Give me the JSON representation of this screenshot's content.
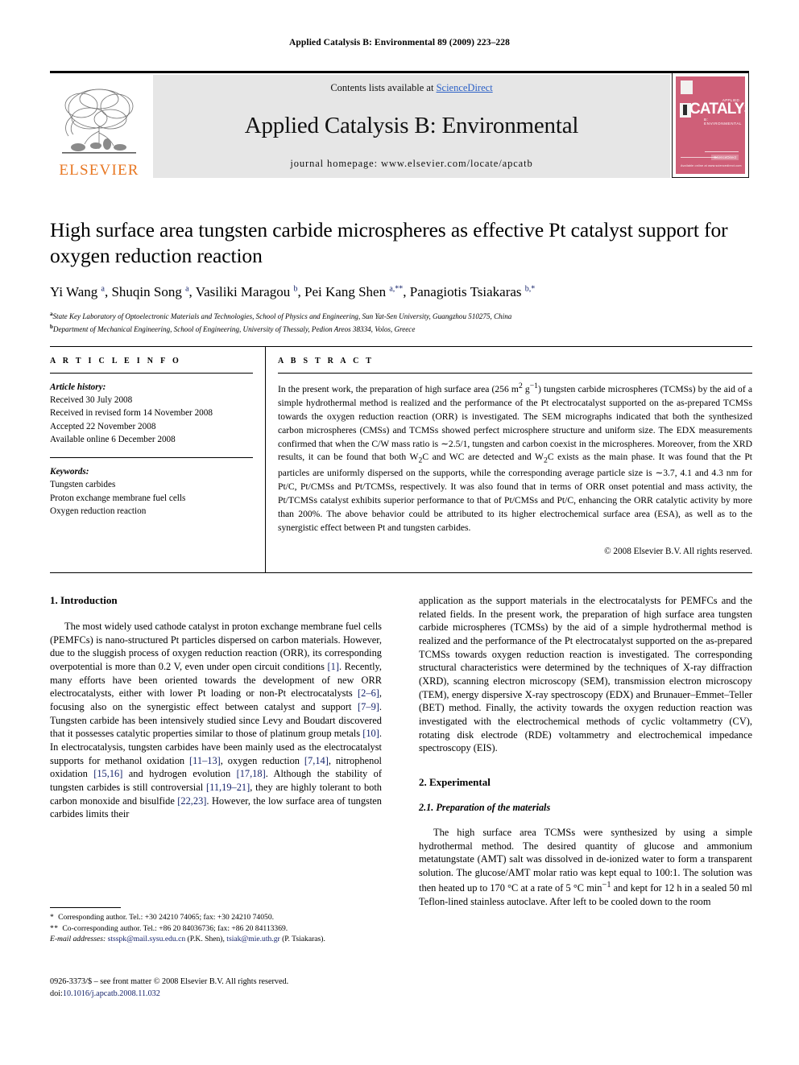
{
  "running_head": "Applied Catalysis B: Environmental 89 (2009) 223–228",
  "masthead": {
    "contents_prefix": "Contents lists available at ",
    "sciencedirect": "ScienceDirect",
    "journal_title": "Applied Catalysis B: Environmental",
    "homepage": "journal homepage: www.elsevier.com/locate/apcatb",
    "publisher_wordmark": "ELSEVIER",
    "cover": {
      "title": "CATALYSIS",
      "overline": "APPLIED",
      "subtitle": "B: ENVIRONMENTAL",
      "badge": "ScienceDirect",
      "footer": "Available online at www.sciencedirect.com"
    }
  },
  "article": {
    "title": "High surface area tungsten carbide microspheres as effective Pt catalyst support for oxygen reduction reaction",
    "authors_html": "Yi Wang <sup>a</sup>, Shuqin Song <sup>a</sup>, Vasiliki Maragou <sup>b</sup>, Pei Kang Shen <sup>a,**</sup>, Panagiotis Tsiakaras <sup>b,*</sup>",
    "affiliations": [
      "State Key Laboratory of Optoelectronic Materials and Technologies, School of Physics and Engineering, Sun Yat-Sen University, Guangzhou 510275, China",
      "Department of Mechanical Engineering, School of Engineering, University of Thessaly, Pedion Areos 38334, Volos, Greece"
    ],
    "affiliation_marks": [
      "a",
      "b"
    ]
  },
  "info": {
    "label": "A R T I C L E  I N F O",
    "history_label": "Article history:",
    "history": [
      "Received 30 July 2008",
      "Received in revised form 14 November 2008",
      "Accepted 22 November 2008",
      "Available online 6 December 2008"
    ],
    "keywords_label": "Keywords:",
    "keywords": [
      "Tungsten carbides",
      "Proton exchange membrane fuel cells",
      "Oxygen reduction reaction"
    ]
  },
  "abstract": {
    "label": "A B S T R A C T",
    "text_html": "In the present work, the preparation of high surface area (256 m<sup>2</sup> g<sup>−1</sup>) tungsten carbide microspheres (TCMSs) by the aid of a simple hydrothermal method is realized and the performance of the Pt electrocatalyst supported on the as-prepared TCMSs towards the oxygen reduction reaction (ORR) is investigated. The SEM micrographs indicated that both the synthesized carbon microspheres (CMSs) and TCMSs showed perfect microsphere structure and uniform size. The EDX measurements confirmed that when the C/W mass ratio is ∼2.5/1, tungsten and carbon coexist in the microspheres. Moreover, from the XRD results, it can be found that both W<sub>2</sub>C and WC are detected and W<sub>2</sub>C exists as the main phase. It was found that the Pt particles are uniformly dispersed on the supports, while the corresponding average particle size is ∼3.7, 4.1 and 4.3 nm for Pt/C, Pt/CMSs and Pt/TCMSs, respectively. It was also found that in terms of ORR onset potential and mass activity, the Pt/TCMSs catalyst exhibits superior performance to that of Pt/CMSs and Pt/C, enhancing the ORR catalytic activity by more than 200%. The above behavior could be attributed to its higher electrochemical surface area (ESA), as well as to the synergistic effect between Pt and tungsten carbides.",
    "copyright": "© 2008 Elsevier B.V. All rights reserved."
  },
  "sections": {
    "introduction_head": "1. Introduction",
    "intro_p1_html": "The most widely used cathode catalyst in proton exchange membrane fuel cells (PEMFCs) is nano-structured Pt particles dispersed on carbon materials. However, due to the sluggish process of oxygen reduction reaction (ORR), its corresponding overpotential is more than 0.2 V, even under open circuit conditions <span class=\"ref\">[1]</span>. Recently, many efforts have been oriented towards the development of new ORR electrocatalysts, either with lower Pt loading or non-Pt electrocatalysts <span class=\"ref\">[2–6]</span>, focusing also on the synergistic effect between catalyst and support <span class=\"ref\">[7–9]</span>. Tungsten carbide has been intensively studied since Levy and Boudart discovered that it possesses catalytic properties similar to those of platinum group metals <span class=\"ref\">[10]</span>. In electrocatalysis, tungsten carbides have been mainly used as the electrocatalyst supports for methanol oxidation <span class=\"ref\">[11–13]</span>, oxygen reduction <span class=\"ref\">[7,14]</span>, nitrophenol oxidation <span class=\"ref\">[15,16]</span> and hydrogen evolution <span class=\"ref\">[17,18]</span>. Although the stability of tungsten carbides is still controversial <span class=\"ref\">[11,19–21]</span>, they are highly tolerant to both carbon monoxide and bisulfide <span class=\"ref\">[22,23]</span>. However, the low surface area of tungsten carbides limits their",
    "intro_p1_cont_html": "application as the support materials in the electrocatalysts for PEMFCs and the related fields. In the present work, the preparation of high surface area tungsten carbide microspheres (TCMSs) by the aid of a simple hydrothermal method is realized and the performance of the Pt electrocatalyst supported on the as-prepared TCMSs towards oxygen reduction reaction is investigated. The corresponding structural characteristics were determined by the techniques of X-ray diffraction (XRD), scanning electron microscopy (SEM), transmission electron microscopy (TEM), energy dispersive X-ray spectroscopy (EDX) and Brunauer–Emmet–Teller (BET) method. Finally, the activity towards the oxygen reduction reaction was investigated with the electrochemical methods of cyclic voltammetry (CV), rotating disk electrode (RDE) voltammetry and electrochemical impedance spectroscopy (EIS).",
    "experimental_head": "2. Experimental",
    "experimental_subhead": "2.1. Preparation of the materials",
    "experimental_p1_html": "The high surface area TCMSs were synthesized by using a simple hydrothermal method. The desired quantity of glucose and ammonium metatungstate (AMT) salt was dissolved in de-ionized water to form a transparent solution. The glucose/AMT molar ratio was kept equal to 100:1. The solution was then heated up to 170 °C at a rate of 5 °C min<sup>−1</sup> and kept for 12 h in a sealed 50 ml Teflon-lined stainless autoclave. After left to be cooled down to the room"
  },
  "footnotes": {
    "corresponding_html": "<span class=\"star\">*</span>&nbsp; Corresponding author. Tel.: +30 24210 74065; fax: +30 24210 74050.",
    "co_corresponding_html": "<span class=\"star\">**</span>&nbsp; Co-corresponding author. Tel.: +86 20 84036736; fax: +86 20 84113369.",
    "email_html": "<span class=\"ital\">E-mail addresses:</span> <span class=\"link\">stsspk@mail.sysu.edu.cn</span> (P.K. Shen), <span class=\"link\">tsiak@mie.uth.gr</span> (P. Tsiakaras)."
  },
  "imprint": {
    "line1_html": "0926-3373/$ – see front matter © 2008 Elsevier B.V. All rights reserved.",
    "line2_prefix": "doi:",
    "line2_doi": "10.1016/j.apcatb.2008.11.032"
  }
}
